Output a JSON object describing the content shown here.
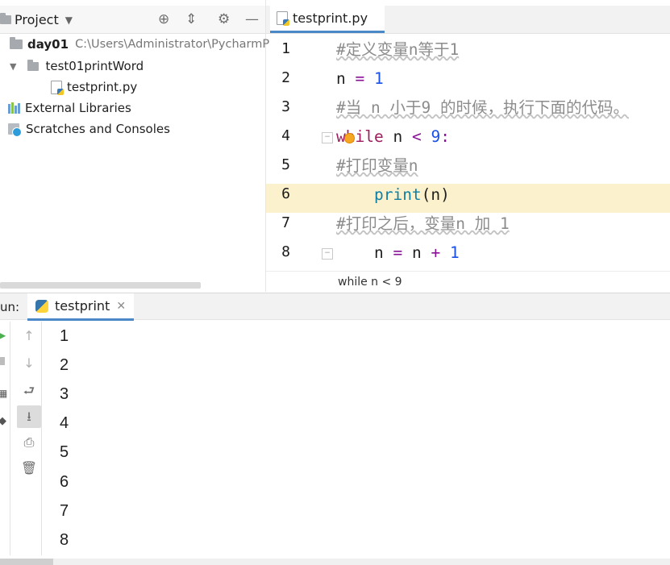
{
  "project": {
    "header_title": "Project",
    "icons": [
      "locate-icon",
      "collapse-icon",
      "gear-icon",
      "minimize-icon"
    ],
    "tree": {
      "root_name": "day01",
      "root_path": "C:\\Users\\Administrator\\PycharmP",
      "subfolder": "test01printWord",
      "file": "testprint.py",
      "external_libraries": "External Libraries",
      "scratches": "Scratches and Consoles"
    }
  },
  "editor": {
    "tab_label": "testprint.py",
    "line_numbers": [
      "1",
      "2",
      "3",
      "4",
      "5",
      "6",
      "7",
      "8"
    ],
    "code": {
      "l1": "#定义变量n等于1",
      "l2_var": "n",
      "l2_op": "=",
      "l2_num": "1",
      "l3": "#当 n 小于9 的时候，执行下面的代码。",
      "l4_kw": "while",
      "l4_var": "n",
      "l4_op": "<",
      "l4_num": "9",
      "l4_colon": ":",
      "l5": "#打印变量n",
      "l6_fn": "print",
      "l6_args": "(n)",
      "l7": "#打印之后，变量n 加 1",
      "l8_var1": "n",
      "l8_op1": "=",
      "l8_var2": "n",
      "l8_op2": "+",
      "l8_num": "1"
    },
    "current_line": "5",
    "breadcrumb": "while n < 9"
  },
  "run": {
    "label": "un:",
    "tab_label": "testprint",
    "output": [
      "1",
      "2",
      "3",
      "4",
      "5",
      "6",
      "7",
      "8"
    ]
  },
  "colors": {
    "accent": "#4a88c7",
    "current_line_bg": "#fbf1cc",
    "keyword": "#9e1d5e",
    "number": "#1750eb",
    "comment": "#8c8c8c",
    "builtin": "#0f7fa4"
  }
}
